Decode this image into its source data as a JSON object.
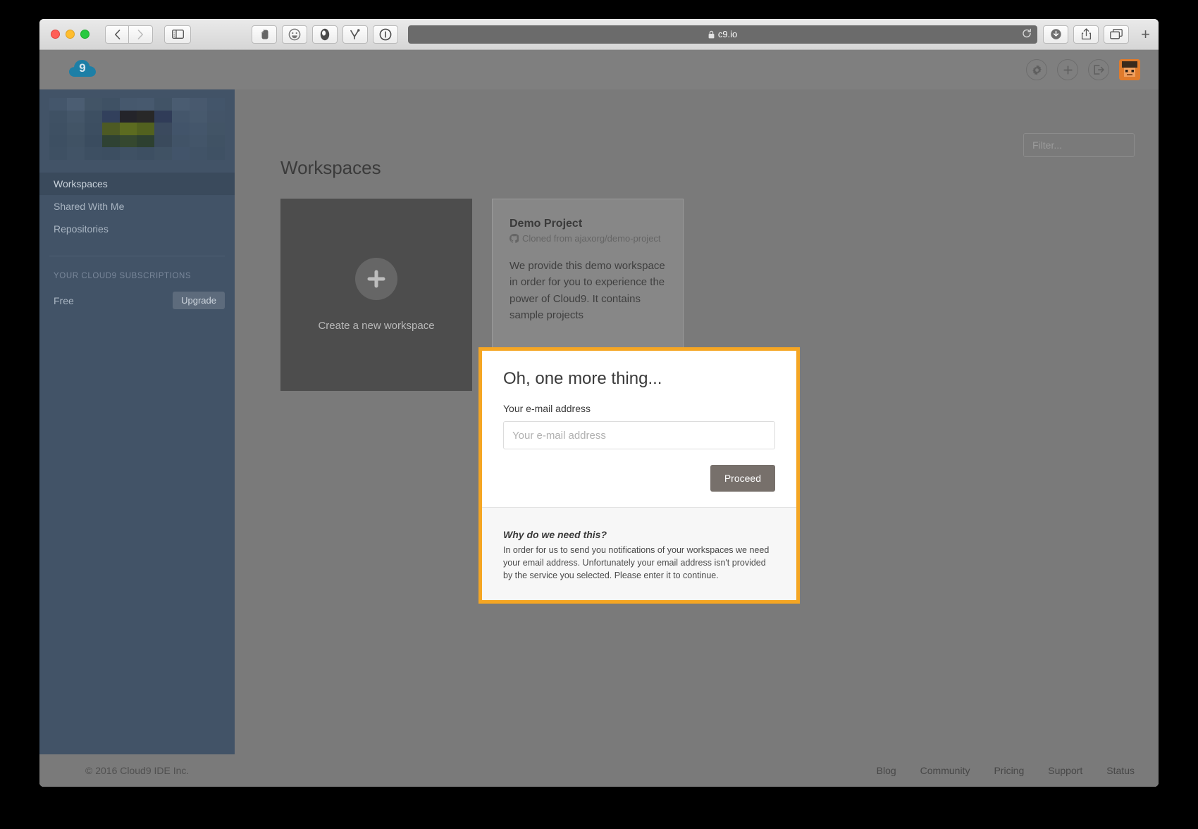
{
  "browser": {
    "url": "c9.io",
    "lock_icon": "lock-icon",
    "traffic_lights": [
      "close",
      "minimize",
      "maximize"
    ],
    "back_icon": "chevron-left-icon",
    "forward_icon": "chevron-right-icon",
    "sidebar_icon": "sidebar-toggle-icon",
    "extensions": [
      {
        "name": "evernote-extension-icon"
      },
      {
        "name": "emoji-extension-icon"
      },
      {
        "name": "adblock-extension-icon"
      },
      {
        "name": "honey-extension-icon"
      },
      {
        "name": "info-extension-icon"
      }
    ],
    "download_icon": "download-icon",
    "share_icon": "share-icon",
    "tabs_icon": "show-tabs-icon",
    "newtab_label": "+",
    "reload_icon": "reload-icon"
  },
  "header": {
    "logo": "cloud9-logo",
    "settings_icon": "gear-icon",
    "add_icon": "plus-icon",
    "logout_icon": "sign-out-icon",
    "avatar": "user-avatar"
  },
  "sidebar": {
    "items": [
      {
        "label": "Workspaces",
        "active": true
      },
      {
        "label": "Shared With Me",
        "active": false
      },
      {
        "label": "Repositories",
        "active": false
      }
    ],
    "section_title": "YOUR CLOUD9 SUBSCRIPTIONS",
    "plan": "Free",
    "upgrade_label": "Upgrade"
  },
  "main": {
    "page_title": "Workspaces",
    "filter_placeholder": "Filter...",
    "filter_value": "",
    "search_icon": "search-icon",
    "new_workspace": {
      "plus_icon": "plus-icon",
      "label": "Create a new workspace"
    },
    "demo_card": {
      "title": "Demo Project",
      "source_icon": "github-icon",
      "source": "Cloned from ajaxorg/demo-project",
      "body": "We provide this demo workspace in order for you to experience the power of Cloud9. It contains sample projects"
    }
  },
  "footer": {
    "copyright": "© 2016   Cloud9 IDE Inc.",
    "links": [
      "Blog",
      "Community",
      "Pricing",
      "Support",
      "Status"
    ]
  },
  "modal": {
    "title": "Oh, one more thing...",
    "field_label": "Your e-mail address",
    "field_placeholder": "Your e-mail address",
    "field_value": "",
    "proceed_label": "Proceed",
    "why_title": "Why do we need this?",
    "why_body": "In order for us to send you notifications of your workspaces we need your email address. Unfortunately your email address isn't provided by the service you selected. Please enter it to continue.",
    "accent_color": "#f5a623"
  }
}
